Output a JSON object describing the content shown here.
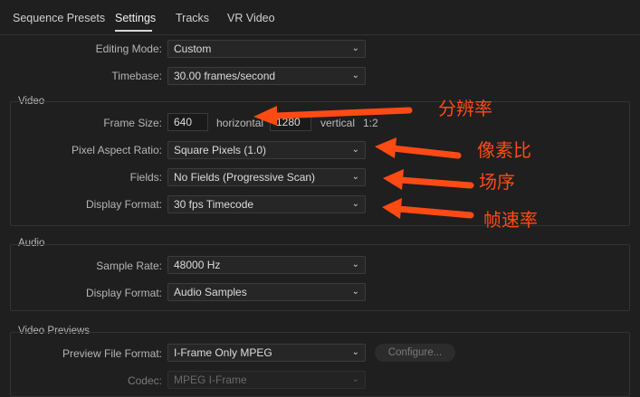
{
  "tabs": [
    "Sequence Presets",
    "Settings",
    "Tracks",
    "VR Video"
  ],
  "general": {
    "editing_mode_label": "Editing Mode:",
    "editing_mode_value": "Custom",
    "timebase_label": "Timebase:",
    "timebase_value": "30.00  frames/second"
  },
  "video": {
    "title": "Video",
    "frame_size_label": "Frame Size:",
    "frame_width": "640",
    "horizontal_label": "horizontal",
    "frame_height": "1280",
    "vertical_label": "vertical",
    "ratio": "1:2",
    "pixel_aspect_label": "Pixel Aspect Ratio:",
    "pixel_aspect_value": "Square Pixels (1.0)",
    "fields_label": "Fields:",
    "fields_value": "No Fields (Progressive Scan)",
    "display_format_label": "Display Format:",
    "display_format_value": "30 fps Timecode"
  },
  "audio": {
    "title": "Audio",
    "sample_rate_label": "Sample Rate:",
    "sample_rate_value": "48000 Hz",
    "display_format_label": "Display Format:",
    "display_format_value": "Audio Samples"
  },
  "video_previews": {
    "title": "Video Previews",
    "preview_format_label": "Preview File Format:",
    "preview_format_value": "I-Frame Only MPEG",
    "configure_label": "Configure...",
    "codec_label": "Codec:",
    "codec_value": "MPEG I-Frame"
  },
  "annotations": {
    "resolution": "分辨率",
    "pixel_aspect": "像素比",
    "fields": "场序",
    "frame_rate": "帧速率",
    "color": "#ff4a14"
  }
}
